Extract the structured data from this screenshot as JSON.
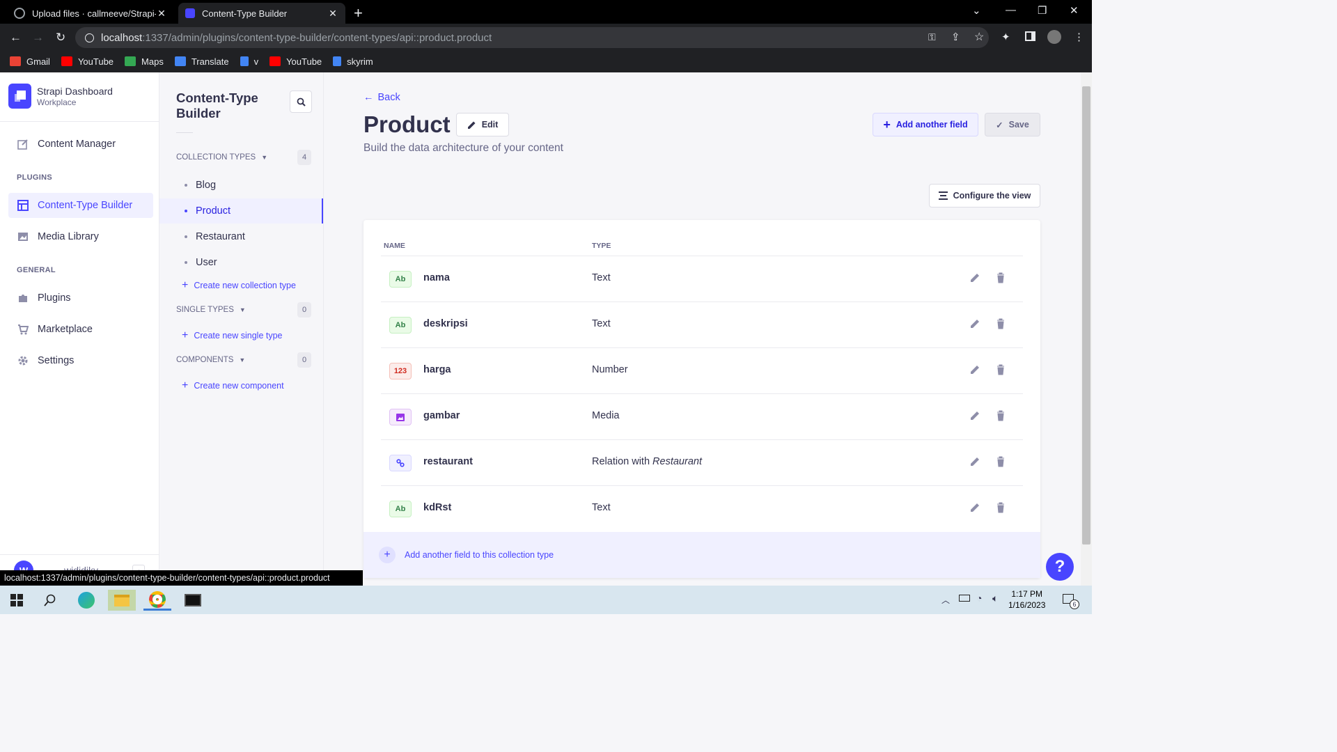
{
  "browser": {
    "tabs": [
      {
        "title": "Upload files · callmeeve/Strapi-Pr"
      },
      {
        "title": "Content-Type Builder"
      }
    ],
    "url_host": "localhost",
    "url_path": ":1337/admin/plugins/content-type-builder/content-types/api::product.product",
    "bookmarks": [
      {
        "label": "Gmail",
        "icon": "gmail-icon",
        "color": "#ea4335"
      },
      {
        "label": "YouTube",
        "icon": "youtube-icon",
        "color": "#ff0000"
      },
      {
        "label": "Maps",
        "icon": "maps-icon",
        "color": "#34a853"
      },
      {
        "label": "Translate",
        "icon": "translate-icon",
        "color": "#4285f4"
      },
      {
        "label": "v",
        "icon": "shield-icon",
        "color": "#4285f4"
      },
      {
        "label": "YouTube",
        "icon": "youtube-icon",
        "color": "#ff0000"
      },
      {
        "label": "skyrim",
        "icon": "shield-icon",
        "color": "#4285f4"
      }
    ],
    "status_url": "localhost:1337/admin/plugins/content-type-builder/content-types/api::product.product"
  },
  "sidebar": {
    "brand_name": "Strapi Dashboard",
    "brand_sub": "Workplace",
    "content_manager": "Content Manager",
    "plugins_label": "PLUGINS",
    "ctb": "Content-Type Builder",
    "media_library": "Media Library",
    "general_label": "GENERAL",
    "plugins": "Plugins",
    "marketplace": "Marketplace",
    "settings": "Settings",
    "user_initial": "W",
    "user_name": "wididiky"
  },
  "ctb": {
    "title_line1": "Content-Type",
    "title_line2": "Builder",
    "collection_types_label": "COLLECTION TYPES",
    "collection_count": "4",
    "collection_items": [
      "Blog",
      "Product",
      "Restaurant",
      "User"
    ],
    "create_collection": "Create new collection type",
    "single_types_label": "SINGLE TYPES",
    "single_count": "0",
    "create_single": "Create new single type",
    "components_label": "COMPONENTS",
    "components_count": "0",
    "create_component": "Create new component"
  },
  "main": {
    "back": "Back",
    "title": "Product",
    "edit": "Edit",
    "subtitle": "Build the data architecture of your content",
    "add_another_field": "Add another field",
    "save": "Save",
    "configure_view": "Configure the view",
    "col_name": "NAME",
    "col_type": "TYPE",
    "fields": [
      {
        "badge": "Ab",
        "kind": "text",
        "name": "nama",
        "type": "Text",
        "target": ""
      },
      {
        "badge": "Ab",
        "kind": "text",
        "name": "deskripsi",
        "type": "Text",
        "target": ""
      },
      {
        "badge": "123",
        "kind": "num",
        "name": "harga",
        "type": "Number",
        "target": ""
      },
      {
        "badge": "",
        "kind": "media",
        "name": "gambar",
        "type": "Media",
        "target": ""
      },
      {
        "badge": "",
        "kind": "rel",
        "name": "restaurant",
        "type": "Relation with ",
        "target": "Restaurant"
      },
      {
        "badge": "Ab",
        "kind": "text",
        "name": "kdRst",
        "type": "Text",
        "target": ""
      }
    ],
    "add_field_collection": "Add another field to this collection type",
    "help": "?"
  },
  "taskbar": {
    "time": "1:17 PM",
    "date": "1/16/2023",
    "notifications": "6"
  }
}
